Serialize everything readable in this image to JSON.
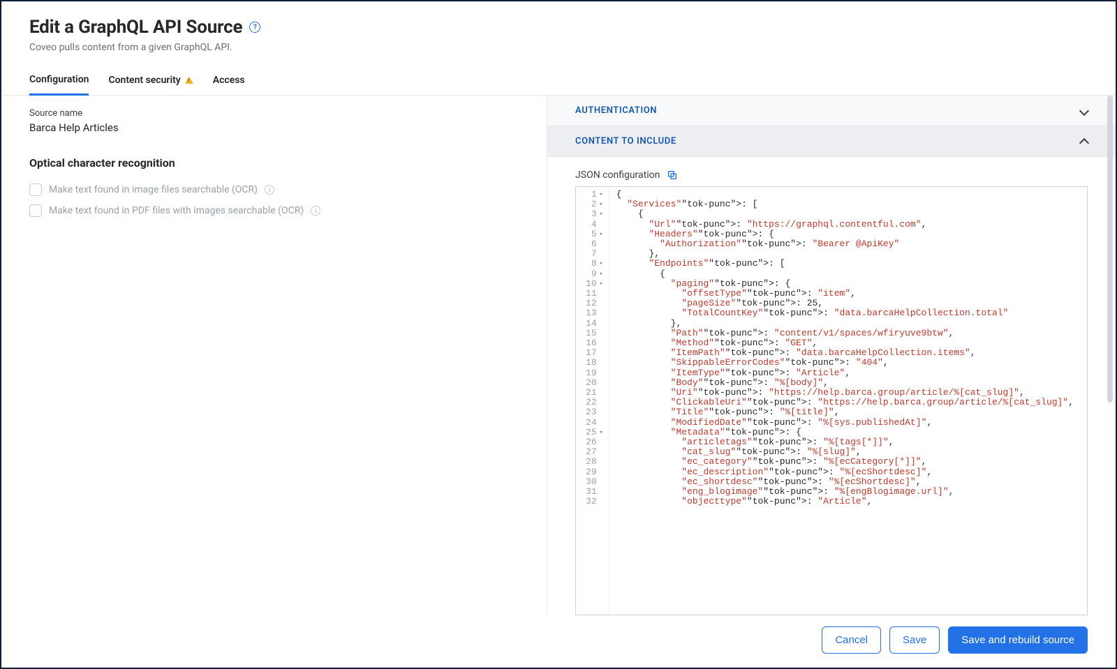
{
  "header": {
    "title": "Edit a GraphQL API Source",
    "subtitle": "Coveo pulls content from a given GraphQL API."
  },
  "tabs": {
    "configuration": "Configuration",
    "content_security": "Content security",
    "access": "Access"
  },
  "left": {
    "source_name_label": "Source name",
    "source_name_value": "Barca Help Articles",
    "ocr_section": "Optical character recognition",
    "ocr_image": "Make text found in image files searchable (OCR)",
    "ocr_pdf": "Make text found in PDF files with images searchable (OCR)"
  },
  "right": {
    "authentication": "AUTHENTICATION",
    "content_to_include": "CONTENT TO INCLUDE",
    "json_label": "JSON configuration"
  },
  "editor": {
    "line_count": 32,
    "fold_lines": [
      1,
      2,
      3,
      5,
      8,
      9,
      10,
      25
    ],
    "lines": [
      "{",
      "  \"Services\": [",
      "    {",
      "      \"Url\": \"https://graphql.contentful.com\",",
      "      \"Headers\": {",
      "        \"Authorization\": \"Bearer @ApiKey\"",
      "      },",
      "      \"Endpoints\": [",
      "        {",
      "          \"paging\": {",
      "            \"offsetType\": \"item\",",
      "            \"pageSize\": 25,",
      "            \"TotalCountKey\": \"data.barcaHelpCollection.total\"",
      "          },",
      "          \"Path\": \"content/v1/spaces/wfiryuve9btw\",",
      "          \"Method\": \"GET\",",
      "          \"ItemPath\": \"data.barcaHelpCollection.items\",",
      "          \"SkippableErrorCodes\": \"404\",",
      "          \"ItemType\": \"Article\",",
      "          \"Body\": \"%[body]\",",
      "          \"Uri\": \"https://help.barca.group/article/%[cat_slug]\",",
      "          \"ClickableUri\": \"https://help.barca.group/article/%[cat_slug]\",",
      "          \"Title\": \"%[title]\",",
      "          \"ModifiedDate\": \"%[sys.publishedAt]\",",
      "          \"Metadata\": {",
      "            \"articletags\": \"%[tags[*]]\",",
      "            \"cat_slug\": \"%[slug]\",",
      "            \"ec_category\": \"%[ecCategory[*]]\",",
      "            \"ec_description\": \"%[ecShortdesc]\",",
      "            \"ec_shortdesc\": \"%[ecShortdesc]\",",
      "            \"eng_blogimage\": \"%[engBlogimage.url]\",",
      "            \"objecttype\": \"Article\","
    ]
  },
  "footer": {
    "cancel": "Cancel",
    "save": "Save",
    "save_rebuild": "Save and rebuild source"
  }
}
